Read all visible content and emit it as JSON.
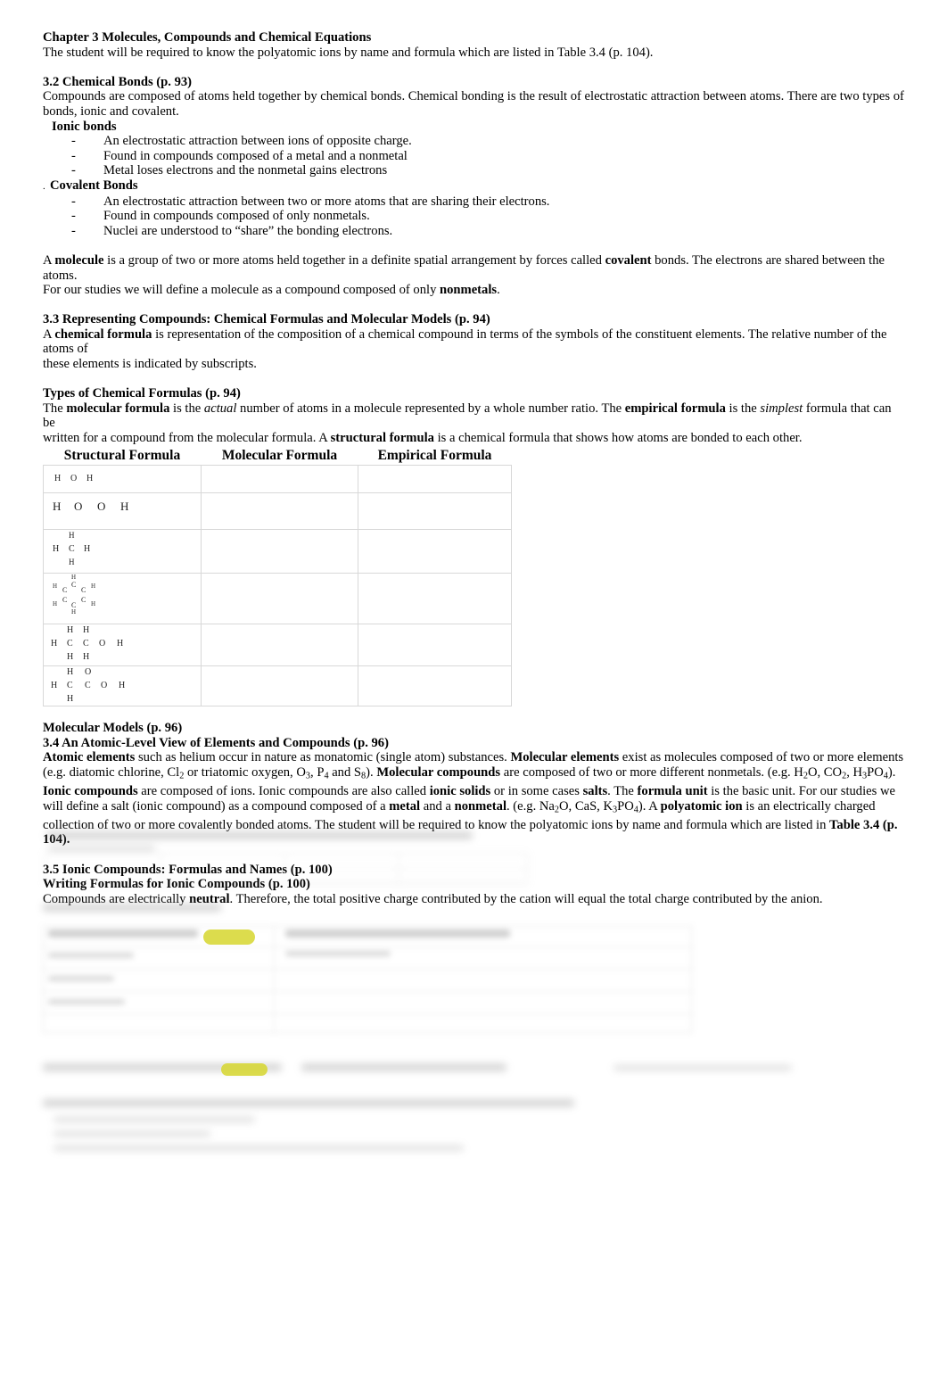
{
  "document": {
    "chapter_title": "Chapter 3 Molecules, Compounds and Chemical Equations",
    "chapter_note": "The student will be required to know the polyatomic ions by name and formula which are listed in Table 3.4 (p. 104).",
    "sections": {
      "s32": {
        "heading": "3.2 Chemical Bonds (p. 93)",
        "intro_line1": "Compounds are composed of atoms held together by chemical bonds.  Chemical bonding is the result of electrostatic attraction between atoms.  There are two types of",
        "intro_line2": "bonds, ionic and covalent.",
        "ionic_label": "Ionic bonds",
        "ionic_bullets": [
          "An electrostatic attraction between ions of opposite charge.",
          "Found in compounds composed of a metal and a nonmetal",
          "Metal loses electrons and the nonmetal gains electrons"
        ],
        "covalent_prefix": ".",
        "covalent_label": "Covalent Bonds",
        "covalent_bullets": [
          "An electrostatic attraction between two or more atoms that are sharing their electrons.",
          "Found in compounds composed of only nonmetals.",
          "Nuclei are understood to “share” the bonding electrons."
        ],
        "molecule_para": {
          "p1": "A ",
          "b1": "molecule",
          "p2": " is a group of two or more atoms held together in a definite spatial arrangement by forces called ",
          "b2": "covalent",
          "p3": " bonds.   The electrons are shared between the atoms.",
          "p4": "For our studies we will define a molecule as a compound composed of only ",
          "b3": "nonmetals",
          "p5": "."
        }
      },
      "s33": {
        "heading": "3.3 Representing Compounds: Chemical Formulas and Molecular Models (p. 94)",
        "para": {
          "p1": "A ",
          "b1": "chemical formula",
          "p2": " is representation of the composition of a chemical compound in terms of the symbols of the constituent elements.  The relative number of the atoms of",
          "p3": "these elements is indicated by subscripts."
        },
        "types_heading": "Types of Chemical Formulas (p. 94)",
        "types_para": {
          "p1": "The ",
          "b1": "molecular formula",
          "p2": " is the ",
          "i1": "actual",
          "p3": " number of atoms in a molecule represented by a whole number ratio.   The ",
          "b2": "empirical formula",
          "p4": " is the ",
          "i2": "simplest",
          "p5": " formula that can be",
          "p6": "written for a compound from the molecular formula.  A ",
          "b3": "structural formula",
          "p7": " is a chemical formula that shows how atoms are bonded to each other."
        }
      },
      "s34": {
        "models_heading": "Molecular Models (p. 96)",
        "heading": "3.4 An Atomic-Level View of Elements and Compounds (p. 96)",
        "paragraph_runs": [
          {
            "t": "Atomic elements",
            "s": "b"
          },
          {
            "t": " such as helium occur in nature as monatomic (single atom) substances.  ",
            "s": "n"
          },
          {
            "t": "Molecular elements",
            "s": "b"
          },
          {
            "t": " exist as molecules composed of two or more elements (e.g. diatomic chlorine, Cl",
            "s": "n"
          },
          {
            "t": "2",
            "s": "sub"
          },
          {
            "t": " or triatomic oxygen, O",
            "s": "n"
          },
          {
            "t": "3",
            "s": "sub"
          },
          {
            "t": ", P",
            "s": "n"
          },
          {
            "t": "4",
            "s": "sub"
          },
          {
            "t": " and S",
            "s": "n"
          },
          {
            "t": "8",
            "s": "sub"
          },
          {
            "t": ").   ",
            "s": "n"
          },
          {
            "t": "Molecular compounds",
            "s": "b"
          },
          {
            "t": " are composed of two or more different nonmetals.  (e.g. H",
            "s": "n"
          },
          {
            "t": "2",
            "s": "sub"
          },
          {
            "t": "O, CO",
            "s": "n"
          },
          {
            "t": "2",
            "s": "sub"
          },
          {
            "t": ", H",
            "s": "n"
          },
          {
            "t": "3",
            "s": "sub"
          },
          {
            "t": "PO",
            "s": "n"
          },
          {
            "t": "4",
            "s": "sub"
          },
          {
            "t": ").   ",
            "s": "n"
          },
          {
            "t": "Ionic compounds",
            "s": "b"
          },
          {
            "t": " are composed of ions.  Ionic compounds are also called ",
            "s": "n"
          },
          {
            "t": "ionic solids",
            "s": "b"
          },
          {
            "t": " or in some cases ",
            "s": "n"
          },
          {
            "t": "salts",
            "s": "b"
          },
          {
            "t": ".  The ",
            "s": "n"
          },
          {
            "t": "formula unit",
            "s": "b"
          },
          {
            "t": " is the basic unit.  For our studies we will define a salt (ionic compound) as a compound composed of a ",
            "s": "n"
          },
          {
            "t": "metal",
            "s": "b"
          },
          {
            "t": " and a ",
            "s": "n"
          },
          {
            "t": "nonmetal",
            "s": "b"
          },
          {
            "t": ". (e.g. Na",
            "s": "n"
          },
          {
            "t": "2",
            "s": "sub"
          },
          {
            "t": "O, CaS, K",
            "s": "n"
          },
          {
            "t": "3",
            "s": "sub"
          },
          {
            "t": "PO",
            "s": "n"
          },
          {
            "t": "4",
            "s": "sub"
          },
          {
            "t": ").  A ",
            "s": "n"
          },
          {
            "t": "polyatomic ion",
            "s": "b"
          },
          {
            "t": " is an electrically charged collection of two or more covalently bonded atoms.   The student will be required to know the polyatomic ions by name and formula which are listed in ",
            "s": "n"
          },
          {
            "t": "Table 3.4 (p. 104).",
            "s": "b"
          }
        ]
      },
      "s35": {
        "heading": "3.5 Ionic Compounds: Formulas and Names (p. 100)",
        "subheading": "Writing Formulas for Ionic Compounds (p. 100)",
        "para": {
          "p1": "Compounds are electrically ",
          "b1": "neutral",
          "p2": ".  Therefore, the total positive charge contributed by the cation will equal the total charge contributed by the anion."
        }
      }
    },
    "formula_table": {
      "headers": [
        "Structural Formula",
        "Molecular Formula",
        "Empirical Formula"
      ],
      "rows": [
        {
          "name": "water",
          "structural_atoms": [
            {
              "t": "H",
              "x": 12,
              "y": 10,
              "size": 10
            },
            {
              "t": "O",
              "x": 30,
              "y": 10,
              "size": 10
            },
            {
              "t": "H",
              "x": 48,
              "y": 10,
              "size": 10
            }
          ],
          "molecular": "",
          "empirical": ""
        },
        {
          "name": "hydrogen-peroxide",
          "structural_atoms": [
            {
              "t": "H",
              "x": 10,
              "y": 8,
              "size": 13
            },
            {
              "t": "O",
              "x": 34,
              "y": 8,
              "size": 13
            },
            {
              "t": "O",
              "x": 60,
              "y": 8,
              "size": 13
            },
            {
              "t": "H",
              "x": 86,
              "y": 8,
              "size": 13
            }
          ],
          "molecular": "",
          "empirical": ""
        },
        {
          "name": "methane",
          "structural_atoms": [
            {
              "t": "H",
              "x": 28,
              "y": 2,
              "size": 9
            },
            {
              "t": "H",
              "x": 10,
              "y": 17,
              "size": 10
            },
            {
              "t": "C",
              "x": 28,
              "y": 17,
              "size": 10
            },
            {
              "t": "H",
              "x": 45,
              "y": 17,
              "size": 10
            },
            {
              "t": "H",
              "x": 28,
              "y": 32,
              "size": 9
            }
          ],
          "molecular": "",
          "empirical": ""
        },
        {
          "name": "benzene",
          "structural_atoms": [
            {
              "t": "H",
              "x": 31,
              "y": 1,
              "size": 7
            },
            {
              "t": "H",
              "x": 10,
              "y": 11,
              "size": 7
            },
            {
              "t": "C",
              "x": 31,
              "y": 9,
              "size": 8
            },
            {
              "t": "C",
              "x": 21,
              "y": 15,
              "size": 8
            },
            {
              "t": "C",
              "x": 42,
              "y": 15,
              "size": 8
            },
            {
              "t": "H",
              "x": 53,
              "y": 11,
              "size": 7
            },
            {
              "t": "C",
              "x": 21,
              "y": 26,
              "size": 8
            },
            {
              "t": "C",
              "x": 42,
              "y": 26,
              "size": 8
            },
            {
              "t": "H",
              "x": 10,
              "y": 31,
              "size": 7
            },
            {
              "t": "C",
              "x": 31,
              "y": 32,
              "size": 8
            },
            {
              "t": "H",
              "x": 53,
              "y": 31,
              "size": 7
            },
            {
              "t": "H",
              "x": 31,
              "y": 40,
              "size": 7
            }
          ],
          "molecular": "",
          "empirical": ""
        },
        {
          "name": "ethanol",
          "structural_atoms": [
            {
              "t": "H",
              "x": 26,
              "y": 2,
              "size": 10
            },
            {
              "t": "H",
              "x": 44,
              "y": 2,
              "size": 10
            },
            {
              "t": "H",
              "x": 8,
              "y": 17,
              "size": 10
            },
            {
              "t": "C",
              "x": 26,
              "y": 17,
              "size": 10
            },
            {
              "t": "C",
              "x": 44,
              "y": 17,
              "size": 10
            },
            {
              "t": "O",
              "x": 62,
              "y": 17,
              "size": 10
            },
            {
              "t": "H",
              "x": 82,
              "y": 17,
              "size": 10
            },
            {
              "t": "H",
              "x": 26,
              "y": 32,
              "size": 10
            },
            {
              "t": "H",
              "x": 44,
              "y": 32,
              "size": 10
            }
          ],
          "molecular": "",
          "empirical": ""
        },
        {
          "name": "acetic-acid",
          "structural_atoms": [
            {
              "t": "H",
              "x": 26,
              "y": 2,
              "size": 10
            },
            {
              "t": "O",
              "x": 46,
              "y": 2,
              "size": 10
            },
            {
              "t": "H",
              "x": 8,
              "y": 17,
              "size": 10
            },
            {
              "t": "C",
              "x": 26,
              "y": 17,
              "size": 10
            },
            {
              "t": "C",
              "x": 46,
              "y": 17,
              "size": 10
            },
            {
              "t": "O",
              "x": 64,
              "y": 17,
              "size": 10
            },
            {
              "t": "H",
              "x": 84,
              "y": 17,
              "size": 10
            },
            {
              "t": "H",
              "x": 26,
              "y": 32,
              "size": 10
            }
          ],
          "molecular": "",
          "empirical": ""
        }
      ]
    },
    "redacted_regions": {
      "note": "illegible blurred content at page bottom",
      "highlight_color": "#d6d62e"
    }
  }
}
